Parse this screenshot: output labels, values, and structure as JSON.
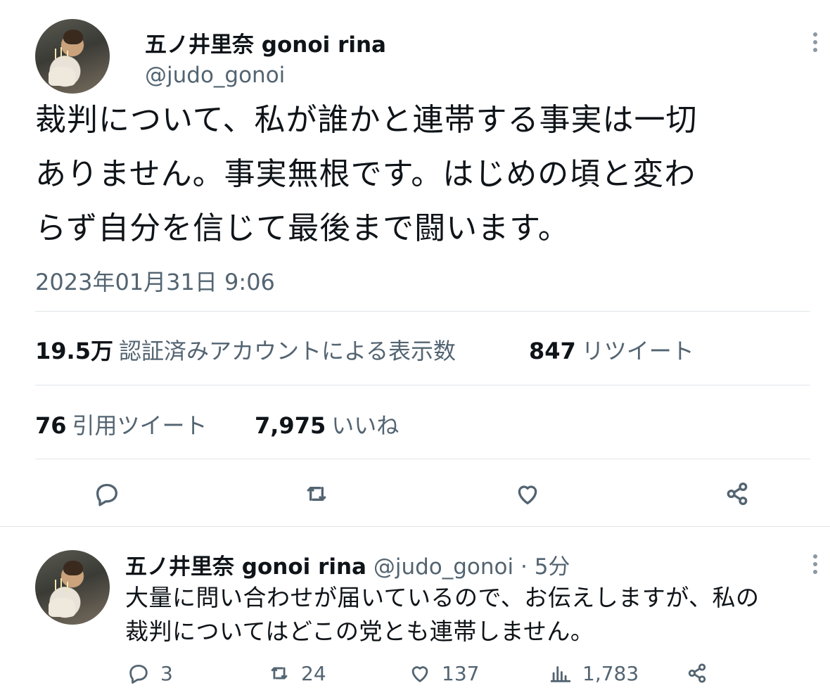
{
  "main_tweet": {
    "author_name": "五ノ井里奈 gonoi rina",
    "handle": "@judo_gonoi",
    "text_lines": [
      "裁判について、私が誰かと連帯する事実は一切",
      "ありません。事実無根です。はじめの頃と変わ",
      "らず自分を信じて最後まで闘います。"
    ],
    "timestamp": "2023年01月31日 9:06",
    "stats": {
      "views_value": "19.5万",
      "views_label": "認証済みアカウントによる表示数",
      "retweets_value": "847",
      "retweets_label": "リツイート",
      "quotes_value": "76",
      "quotes_label": "引用ツイート",
      "likes_value": "7,975",
      "likes_label": "いいね"
    },
    "actions": [
      "reply-icon",
      "retweet-icon",
      "like-icon",
      "share-icon"
    ]
  },
  "reply_tweet": {
    "author_name": "五ノ井里奈 gonoi rina",
    "handle": "@judo_gonoi",
    "separator": "·",
    "time": "5分",
    "text_lines": [
      "大量に問い合わせが届いているので、お伝えしますが、私の",
      "裁判についてはどこの党とも連帯しません。"
    ],
    "actions": {
      "replies": "3",
      "retweets": "24",
      "likes": "137",
      "views": "1,783"
    }
  },
  "colors": {
    "text": "#0f1419",
    "secondary": "#536471",
    "divider": "#e1e6ea"
  }
}
